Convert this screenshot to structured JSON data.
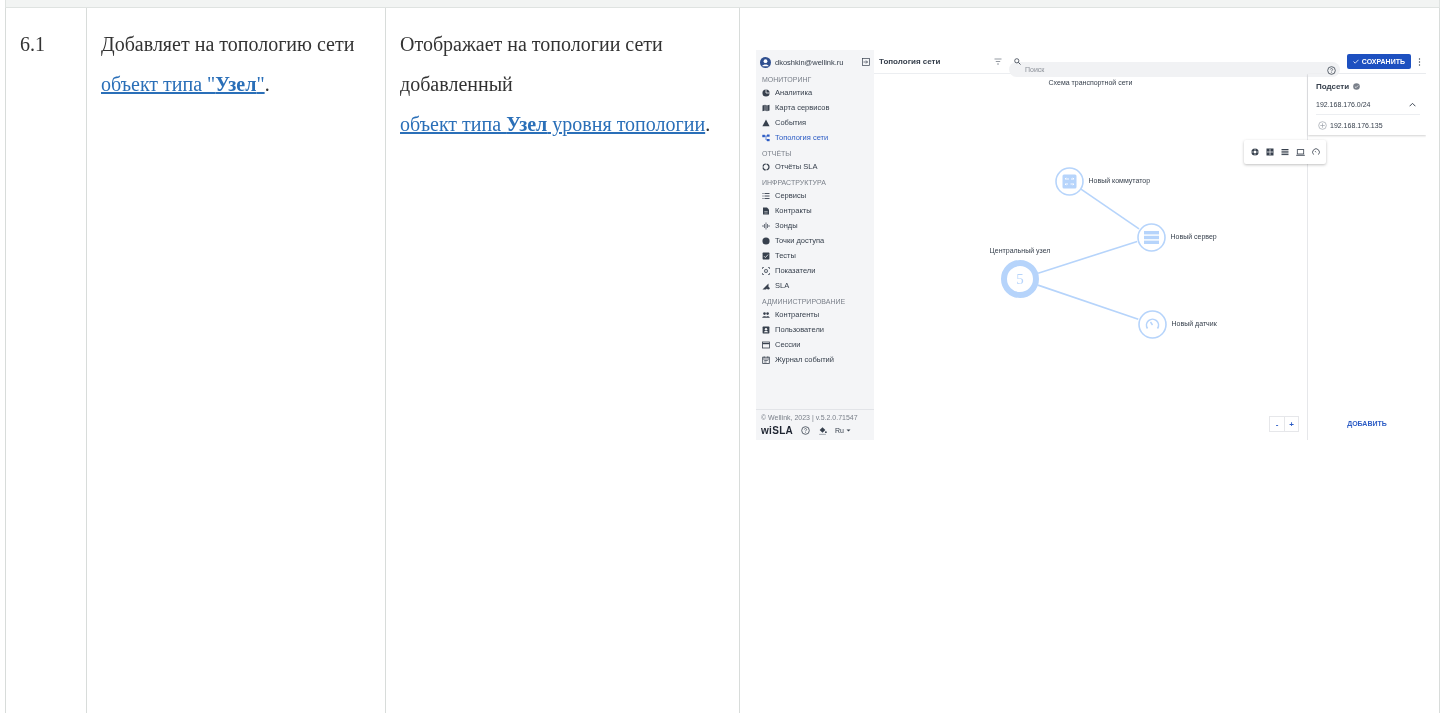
{
  "table": {
    "rows": [
      {
        "number": "6.1",
        "action": {
          "before": "Добавляет на топологию сети ",
          "link": "объект типа \"**Узел**\"",
          "after": "."
        },
        "result": {
          "before": "Отображает на топологии сети добавленный ",
          "link": "объект типа **Узел** уровня топологии",
          "after": "."
        },
        "screenshot": {
          "sidebar": {
            "user": "dkoshkin@wellink.ru",
            "sections": [
              {
                "title": "МОНИТОРИНГ",
                "items": [
                  {
                    "label": "Аналитика",
                    "selected": false
                  },
                  {
                    "label": "Карта сервисов",
                    "selected": false
                  },
                  {
                    "label": "События",
                    "selected": false
                  },
                  {
                    "label": "Топология сети",
                    "selected": true
                  }
                ]
              },
              {
                "title": "ОТЧЁТЫ",
                "items": [
                  {
                    "label": "Отчёты SLA",
                    "selected": false
                  }
                ]
              },
              {
                "title": "ИНФРАСТРУКТУРА",
                "items": [
                  {
                    "label": "Сервисы",
                    "selected": false
                  },
                  {
                    "label": "Контракты",
                    "selected": false
                  },
                  {
                    "label": "Зонды",
                    "selected": false
                  },
                  {
                    "label": "Точки доступа",
                    "selected": false
                  },
                  {
                    "label": "Тесты",
                    "selected": false
                  },
                  {
                    "label": "Показатели",
                    "selected": false
                  },
                  {
                    "label": "SLA",
                    "selected": false
                  }
                ]
              },
              {
                "title": "АДМИНИСТРИРОВАНИЕ",
                "items": [
                  {
                    "label": "Контрагенты",
                    "selected": false
                  },
                  {
                    "label": "Пользователи",
                    "selected": false
                  },
                  {
                    "label": "Сессии",
                    "selected": false
                  },
                  {
                    "label": "Журнал событий",
                    "selected": false
                  }
                ]
              }
            ],
            "copyright": "© Wellink, 2023 | v.5.2.0.71547",
            "logo": "wiSLA",
            "language": "Ru"
          },
          "topbar": {
            "title": "Топология сети",
            "search": {
              "placeholder": "Поиск"
            },
            "save_button": "СОХРАНИТЬ"
          },
          "canvas": {
            "title": "Схема транспортной сети",
            "nodes": [
              {
                "kind": "switch",
                "label": "Новый коммутатор"
              },
              {
                "kind": "server",
                "label": "Новый сервер"
              },
              {
                "kind": "hub",
                "label": "Центральный узел",
                "badge": "5"
              },
              {
                "kind": "sensor",
                "label": "Новый датчик"
              }
            ],
            "zoom_buttons": [
              "-",
              "+"
            ]
          },
          "subnets": {
            "title": "Подсети",
            "items": [
              {
                "label": "192.168.176.0/24",
                "expanded": true,
                "children": [
                  {
                    "label": "192.168.176.135"
                  }
                ]
              }
            ],
            "add_button": "ДОБАВИТЬ"
          }
        }
      }
    ]
  }
}
